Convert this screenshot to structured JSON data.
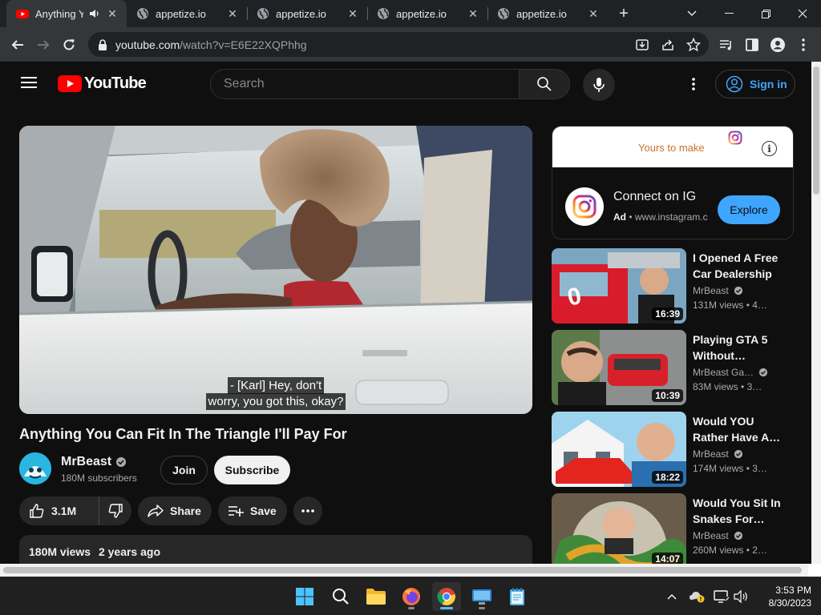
{
  "browser": {
    "tabs": [
      {
        "title": "Anything Yo",
        "active": true
      },
      {
        "title": "appetize.io",
        "active": false
      },
      {
        "title": "appetize.io",
        "active": false
      },
      {
        "title": "appetize.io",
        "active": false
      },
      {
        "title": "appetize.io",
        "active": false
      }
    ],
    "url_host": "youtube.com",
    "url_path": "/watch?v=E6E22XQPhhg"
  },
  "header": {
    "logo_text": "YouTube",
    "search_placeholder": "Search",
    "signin_label": "Sign in"
  },
  "player": {
    "caption_line1": "- [Karl] Hey, don't",
    "caption_line2": "worry, you got this, okay?"
  },
  "video": {
    "title": "Anything You Can Fit In The Triangle I'll Pay For",
    "channel": "MrBeast",
    "subscribers": "180M subscribers",
    "join_label": "Join",
    "subscribe_label": "Subscribe",
    "likes": "3.1M",
    "share_label": "Share",
    "save_label": "Save",
    "views": "180M views",
    "age": "2 years ago"
  },
  "ad": {
    "tagline": "Yours to make",
    "headline": "Connect on IG",
    "badge": "Ad",
    "domain": "www.instagram.com",
    "cta": "Explore"
  },
  "recommendations": [
    {
      "title": "I Opened A Free Car Dealership",
      "channel": "MrBeast",
      "views": "131M views",
      "age": "4…",
      "duration": "16:39"
    },
    {
      "title": "Playing GTA 5 Without…",
      "channel": "MrBeast Ga…",
      "views": "83M views",
      "age": "3…",
      "duration": "10:39"
    },
    {
      "title": "Would YOU Rather Have A…",
      "channel": "MrBeast",
      "views": "174M views",
      "age": "3…",
      "duration": "18:22"
    },
    {
      "title": "Would You Sit In Snakes For…",
      "channel": "MrBeast",
      "views": "260M views",
      "age": "2…",
      "duration": "14:07"
    }
  ],
  "taskbar": {
    "time": "3:53 PM",
    "date": "8/30/2023"
  },
  "colors": {
    "yt_red": "#ff0000",
    "link_blue": "#3ea6ff",
    "windows_blue": "#4cc2ff"
  }
}
